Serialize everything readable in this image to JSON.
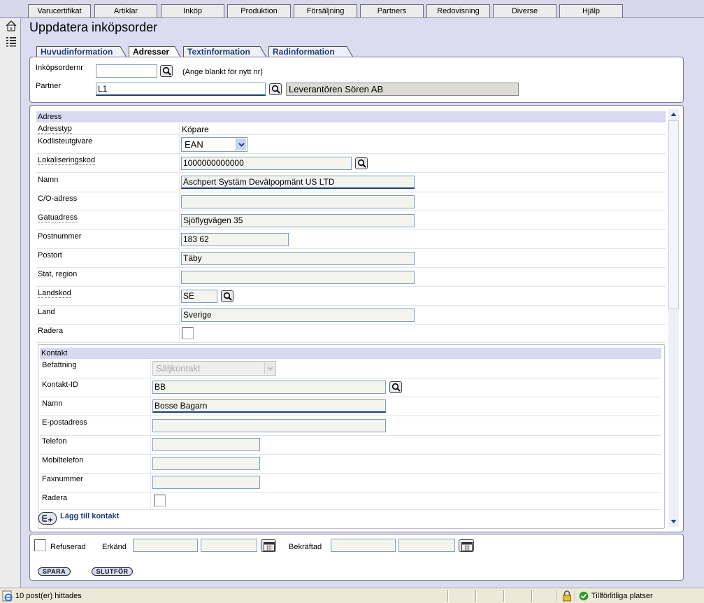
{
  "menu": {
    "items": [
      "Varucertifikat",
      "Artiklar",
      "Inköp",
      "Produktion",
      "Försäljning",
      "Partners",
      "Redovisning",
      "Diverse",
      "Hjälp"
    ]
  },
  "page": {
    "title": "Uppdatera inköpsorder"
  },
  "tabs": [
    {
      "label": "Huvudinformation"
    },
    {
      "label": "Adresser"
    },
    {
      "label": "Textinformation"
    },
    {
      "label": "Radinformation"
    }
  ],
  "header": {
    "order_no_label": "Inköpsordernr",
    "order_no_value": "",
    "order_no_hint": "(Ange blankt för nytt nr)",
    "partner_label": "Partner",
    "partner_value": "L1",
    "partner_name": "Leverantören Sören AB"
  },
  "address": {
    "section_title": "Adress",
    "type_label": "Adresstyp",
    "type_value": "Köpare",
    "codelist_label": "Kodlisteutgivare",
    "codelist_value": "EAN",
    "location_code_label": "Lokaliseringskod",
    "location_code_value": "1000000000000",
    "name_label": "Namn",
    "name_value": "Äschpert Systäm Devälpopmänt US LTD",
    "co_label": "C/O-adress",
    "co_value": "",
    "street_label": "Gatuadress",
    "street_value": "Sjöflygvägen 35",
    "postal_code_label": "Postnummer",
    "postal_code_value": "183 62",
    "city_label": "Postort",
    "city_value": "Täby",
    "state_label": "Stat, region",
    "state_value": "",
    "country_code_label": "Landskod",
    "country_code_value": "SE",
    "country_label": "Land",
    "country_value": "Sverige",
    "delete_label": "Radera"
  },
  "contact": {
    "section_title": "Kontakt",
    "position_label": "Befattning",
    "position_value": "Säljkontakt",
    "contact_id_label": "Kontakt-ID",
    "contact_id_value": "BB",
    "name_label": "Namn",
    "name_value": "Bosse Bagarn",
    "email_label": "E-postadress",
    "email_value": "",
    "phone_label": "Telefon",
    "phone_value": "",
    "mobile_label": "Mobiltelefon",
    "mobile_value": "",
    "fax_label": "Faxnummer",
    "fax_value": "",
    "delete_label": "Radera",
    "add_contact_label": "Lägg till kontakt"
  },
  "footer": {
    "refused_label": "Refuserad",
    "acknowledged_label": "Erkänd",
    "acknowledged_date": "",
    "acknowledged_time": "",
    "confirmed_label": "Bekräftad",
    "confirmed_date": "",
    "confirmed_time": "",
    "save_label": "SPARA",
    "finish_label": "SLUTFÖR"
  },
  "statusbar": {
    "left_text": "10 post(er) hittades",
    "zone_text": "Tillförlitliga platser"
  },
  "colors": {
    "background": "#dcdcf0",
    "tab_text": "#1c3e7a",
    "section_header": "#d8d8f0"
  }
}
